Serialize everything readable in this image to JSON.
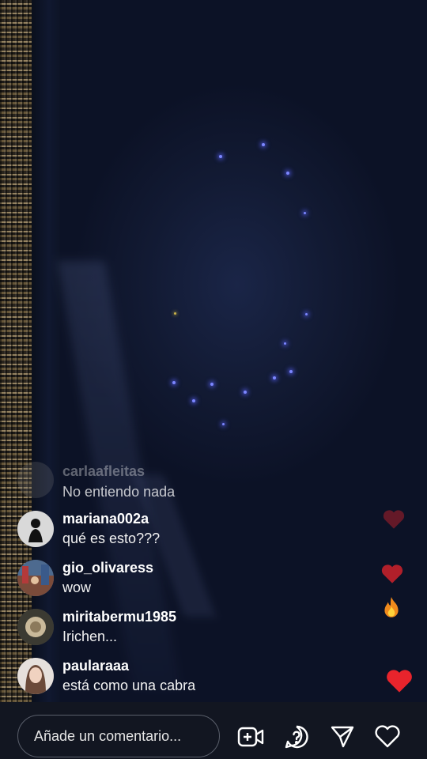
{
  "comments": [
    {
      "username": "carlaafleitas",
      "text": "No entiendo nada"
    },
    {
      "username": "mariana002a",
      "text": "qué es esto???"
    },
    {
      "username": "gio_olivaress",
      "text": "wow"
    },
    {
      "username": "miritabermu1985",
      "text": "Irichen..."
    },
    {
      "username": "paularaaa",
      "text": "está como una cabra"
    }
  ],
  "input": {
    "placeholder": "Añade un comentario..."
  },
  "actions": {
    "icons": [
      "add-video-icon",
      "question-icon",
      "send-icon",
      "heart-icon"
    ]
  },
  "reactions": [
    "heart-icon",
    "heart-icon",
    "fire-icon",
    "heart-icon"
  ],
  "colors": {
    "accent_heart": "#e8242c",
    "background": "#0c1226",
    "bar": "#121621"
  }
}
